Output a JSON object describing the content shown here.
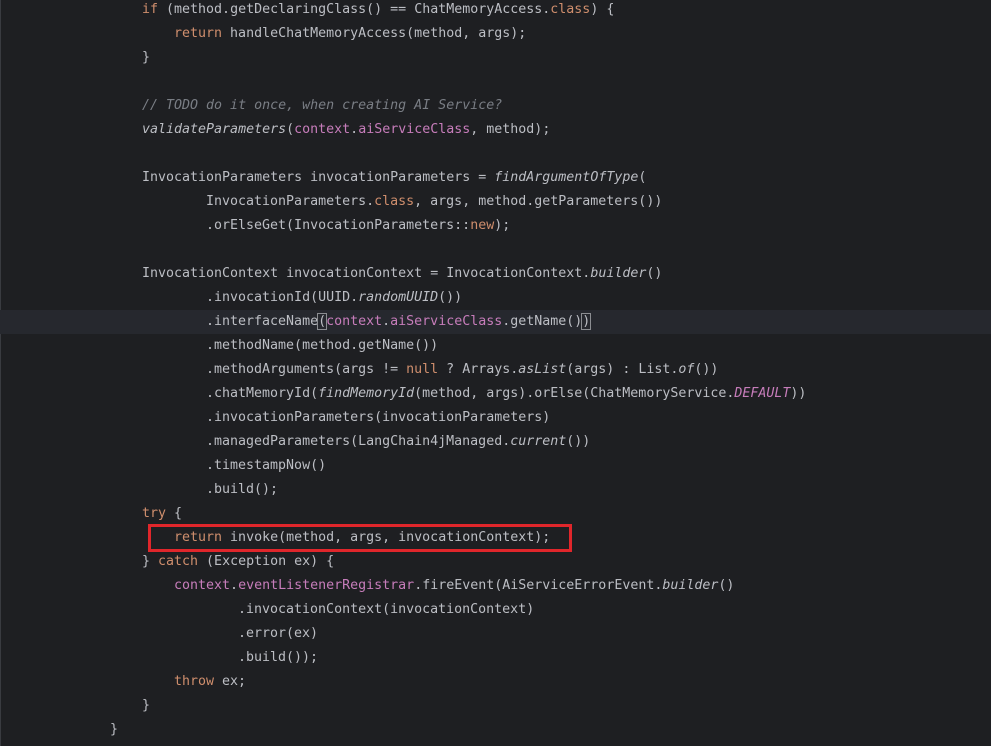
{
  "editor": {
    "lines": [
      {
        "indent": 142,
        "tokens": [
          {
            "t": "if",
            "c": "kw"
          },
          {
            "t": " (method.getDeclaringClass() == ChatMemoryAccess."
          },
          {
            "t": "class",
            "c": "kw"
          },
          {
            "t": ") {"
          }
        ]
      },
      {
        "indent": 174,
        "tokens": [
          {
            "t": "return",
            "c": "kw"
          },
          {
            "t": " handleChatMemoryAccess(method, args);"
          }
        ]
      },
      {
        "indent": 142,
        "tokens": [
          {
            "t": "}"
          }
        ]
      },
      {
        "indent": 142,
        "tokens": []
      },
      {
        "indent": 142,
        "tokens": [
          {
            "t": "// TODO do it once, when creating AI Service?",
            "c": "cm"
          }
        ]
      },
      {
        "indent": 142,
        "tokens": [
          {
            "t": "validateParameters",
            "c": "it"
          },
          {
            "t": "("
          },
          {
            "t": "context",
            "c": "fld"
          },
          {
            "t": "."
          },
          {
            "t": "aiServiceClass",
            "c": "fld"
          },
          {
            "t": ", method);"
          }
        ]
      },
      {
        "indent": 142,
        "tokens": []
      },
      {
        "indent": 142,
        "tokens": [
          {
            "t": "InvocationParameters invocationParameters = "
          },
          {
            "t": "findArgumentOfType",
            "c": "it"
          },
          {
            "t": "("
          }
        ]
      },
      {
        "indent": 206,
        "tokens": [
          {
            "t": "InvocationParameters."
          },
          {
            "t": "class",
            "c": "kw"
          },
          {
            "t": ", args, method.getParameters())"
          }
        ]
      },
      {
        "indent": 206,
        "tokens": [
          {
            "t": ".orElseGet(InvocationParameters::"
          },
          {
            "t": "new",
            "c": "kw"
          },
          {
            "t": ");"
          }
        ]
      },
      {
        "indent": 142,
        "tokens": []
      },
      {
        "indent": 142,
        "tokens": [
          {
            "t": "InvocationContext invocationContext = InvocationContext."
          },
          {
            "t": "builder",
            "c": "it"
          },
          {
            "t": "()"
          }
        ]
      },
      {
        "indent": 206,
        "tokens": [
          {
            "t": ".invocationId(UUID."
          },
          {
            "t": "randomUUID",
            "c": "it"
          },
          {
            "t": "())"
          }
        ]
      },
      {
        "indent": 206,
        "caret": true,
        "tokens": [
          {
            "t": ".interfaceName"
          },
          {
            "t": "(",
            "c": "brace-hl"
          },
          {
            "t": "context",
            "c": "fld"
          },
          {
            "t": "."
          },
          {
            "t": "aiServiceClass",
            "c": "fld"
          },
          {
            "t": ".getName()"
          },
          {
            "t": ")",
            "c": "brace-hl"
          }
        ]
      },
      {
        "indent": 206,
        "tokens": [
          {
            "t": ".methodName(method.getName())"
          }
        ]
      },
      {
        "indent": 206,
        "tokens": [
          {
            "t": ".methodArguments(args != "
          },
          {
            "t": "null",
            "c": "kw"
          },
          {
            "t": " ? Arrays."
          },
          {
            "t": "asList",
            "c": "it"
          },
          {
            "t": "(args) : List."
          },
          {
            "t": "of",
            "c": "it"
          },
          {
            "t": "())"
          }
        ]
      },
      {
        "indent": 206,
        "tokens": [
          {
            "t": ".chatMemoryId("
          },
          {
            "t": "findMemoryId",
            "c": "it"
          },
          {
            "t": "(method, args).orElse(ChatMemoryService."
          },
          {
            "t": "DEFAULT",
            "c": "cst"
          },
          {
            "t": "))"
          }
        ]
      },
      {
        "indent": 206,
        "tokens": [
          {
            "t": ".invocationParameters(invocationParameters)"
          }
        ]
      },
      {
        "indent": 206,
        "tokens": [
          {
            "t": ".managedParameters(LangChain4jManaged."
          },
          {
            "t": "current",
            "c": "it"
          },
          {
            "t": "())"
          }
        ]
      },
      {
        "indent": 206,
        "tokens": [
          {
            "t": ".timestampNow()"
          }
        ]
      },
      {
        "indent": 206,
        "tokens": [
          {
            "t": ".build();"
          }
        ]
      },
      {
        "indent": 142,
        "tokens": [
          {
            "t": "try",
            "c": "kw"
          },
          {
            "t": " {"
          }
        ]
      },
      {
        "indent": 174,
        "tokens": [
          {
            "t": "return",
            "c": "kw"
          },
          {
            "t": " invoke(method, args, invocationContext);"
          }
        ]
      },
      {
        "indent": 142,
        "tokens": [
          {
            "t": "} "
          },
          {
            "t": "catch",
            "c": "kw"
          },
          {
            "t": " (Exception ex) {"
          }
        ]
      },
      {
        "indent": 174,
        "tokens": [
          {
            "t": "context",
            "c": "fld"
          },
          {
            "t": "."
          },
          {
            "t": "eventListenerRegistrar",
            "c": "fld"
          },
          {
            "t": ".fireEvent(AiServiceErrorEvent."
          },
          {
            "t": "builder",
            "c": "it"
          },
          {
            "t": "()"
          }
        ]
      },
      {
        "indent": 238,
        "tokens": [
          {
            "t": ".invocationContext(invocationContext)"
          }
        ]
      },
      {
        "indent": 238,
        "tokens": [
          {
            "t": ".error(ex)"
          }
        ]
      },
      {
        "indent": 238,
        "tokens": [
          {
            "t": ".build());"
          }
        ]
      },
      {
        "indent": 174,
        "tokens": [
          {
            "t": "throw",
            "c": "kw"
          },
          {
            "t": " ex;"
          }
        ]
      },
      {
        "indent": 142,
        "tokens": [
          {
            "t": "}"
          }
        ]
      },
      {
        "indent": 110,
        "tokens": [
          {
            "t": "}"
          }
        ]
      }
    ],
    "highlight": {
      "line_index": 22,
      "color": "#e0262b"
    },
    "colors": {
      "background": "#1e1f22",
      "text": "#bcbec4",
      "keyword": "#cf8e6d",
      "field": "#c77dbb",
      "comment": "#7a7e85"
    }
  }
}
